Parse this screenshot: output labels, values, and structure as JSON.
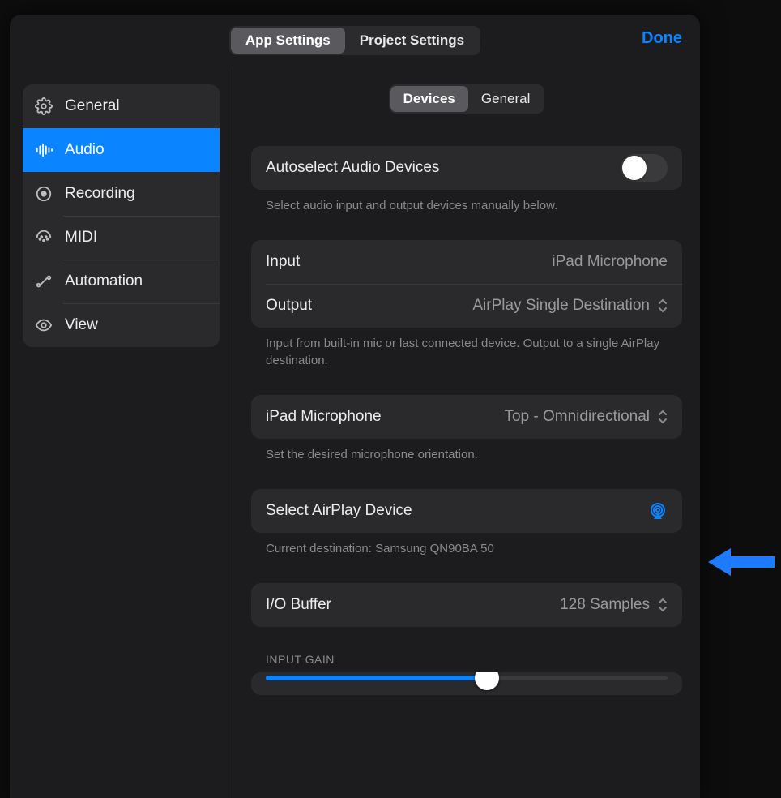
{
  "header": {
    "tabs": {
      "app": "App Settings",
      "project": "Project Settings"
    },
    "done": "Done"
  },
  "sidebar": {
    "items": [
      {
        "label": "General"
      },
      {
        "label": "Audio"
      },
      {
        "label": "Recording"
      },
      {
        "label": "MIDI"
      },
      {
        "label": "Automation"
      },
      {
        "label": "View"
      }
    ]
  },
  "subtabs": {
    "devices": "Devices",
    "general": "General"
  },
  "autoselect": {
    "label": "Autoselect Audio Devices",
    "note": "Select audio input and output devices manually below."
  },
  "io": {
    "input_label": "Input",
    "input_value": "iPad Microphone",
    "output_label": "Output",
    "output_value": "AirPlay Single Destination",
    "note": "Input from built-in mic or last connected device. Output to a single AirPlay destination."
  },
  "mic": {
    "label": "iPad Microphone",
    "value": "Top - Omnidirectional",
    "note": "Set the desired microphone orientation."
  },
  "airplay": {
    "label": "Select AirPlay Device",
    "note": "Current destination: Samsung QN90BA 50"
  },
  "buffer": {
    "label": "I/O Buffer",
    "value": "128 Samples"
  },
  "gain": {
    "header": "INPUT GAIN",
    "percent": 55
  }
}
